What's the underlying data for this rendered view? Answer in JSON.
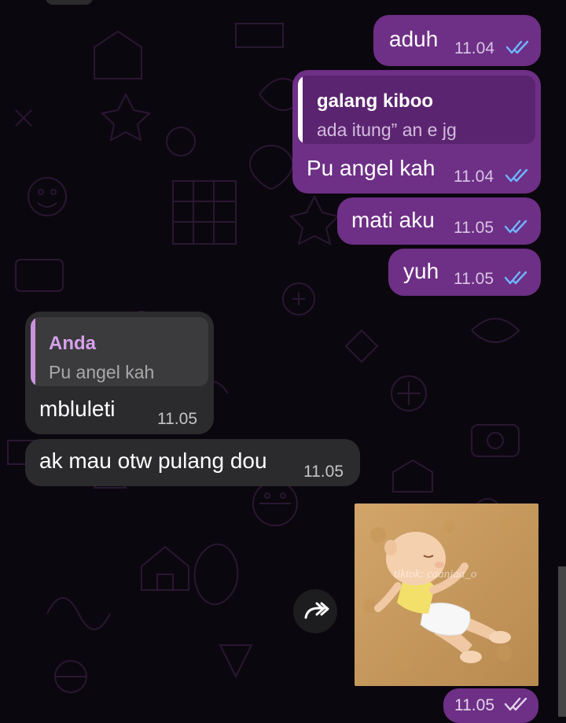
{
  "chat": {
    "messages": [
      {
        "direction": "out",
        "text": "aduh",
        "time": "11.04",
        "status": "read"
      },
      {
        "direction": "out",
        "quote": {
          "author": "galang kiboo",
          "text": "ada itung” an e jg"
        },
        "text": "Pu angel kah",
        "time": "11.04",
        "status": "read"
      },
      {
        "direction": "out",
        "text": "mati aku",
        "time": "11.05",
        "status": "read"
      },
      {
        "direction": "out",
        "text": "yuh",
        "time": "11.05",
        "status": "read"
      },
      {
        "direction": "in",
        "quote": {
          "author": "Anda",
          "text": "Pu angel kah"
        },
        "text": "mbluleti",
        "time": "11.05"
      },
      {
        "direction": "in",
        "text": "ak mau otw pulang dou",
        "time": "11.05"
      },
      {
        "direction": "out",
        "type": "sticker",
        "watermark": "tiktok: caaniaa_o",
        "time": "11.05",
        "status": "delivered"
      }
    ]
  },
  "icons": {
    "read_ticks": "double-check-icon",
    "forward": "forward-arrow-icon"
  },
  "colors": {
    "background": "#0b070e",
    "outgoing_bubble": "#6e2f86",
    "incoming_bubble": "#2b2b2d",
    "read_tick": "#6eb7ff",
    "incoming_quote_accent": "#d7a1ea"
  }
}
